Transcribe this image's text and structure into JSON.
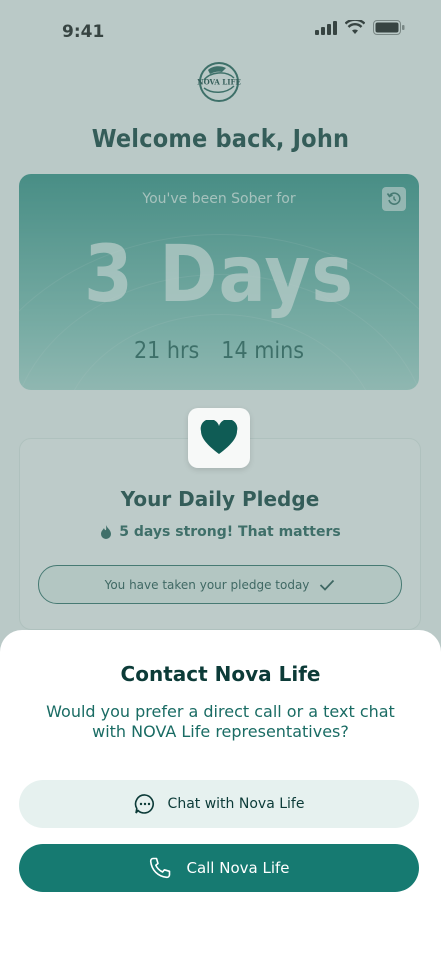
{
  "status_bar": {
    "time": "9:41"
  },
  "logo": {
    "text": "NOVA LIFE"
  },
  "header": {
    "welcome": "Welcome back, John"
  },
  "sober_card": {
    "label": "You've been Sober for",
    "days": "3 Days",
    "hours": "21 hrs",
    "minutes": "14 mins"
  },
  "pledge_card": {
    "title": "Your Daily Pledge",
    "streak": "5 days strong! That matters",
    "status": "You have taken your pledge today"
  },
  "contact_sheet": {
    "title": "Contact Nova Life",
    "body": "Would you prefer a direct call or a text chat with NOVA Life representatives?",
    "chat_label": "Chat with Nova Life",
    "call_label": "Call Nova Life"
  },
  "colors": {
    "brand_dark": "#0c3b38",
    "brand_teal": "#167a71",
    "chat_bg": "#e6f1ef"
  },
  "icons": [
    "signal-icon",
    "wifi-icon",
    "battery-icon",
    "reset-icon",
    "heart-icon",
    "flame-icon",
    "check-icon",
    "chat-icon",
    "phone-icon"
  ]
}
